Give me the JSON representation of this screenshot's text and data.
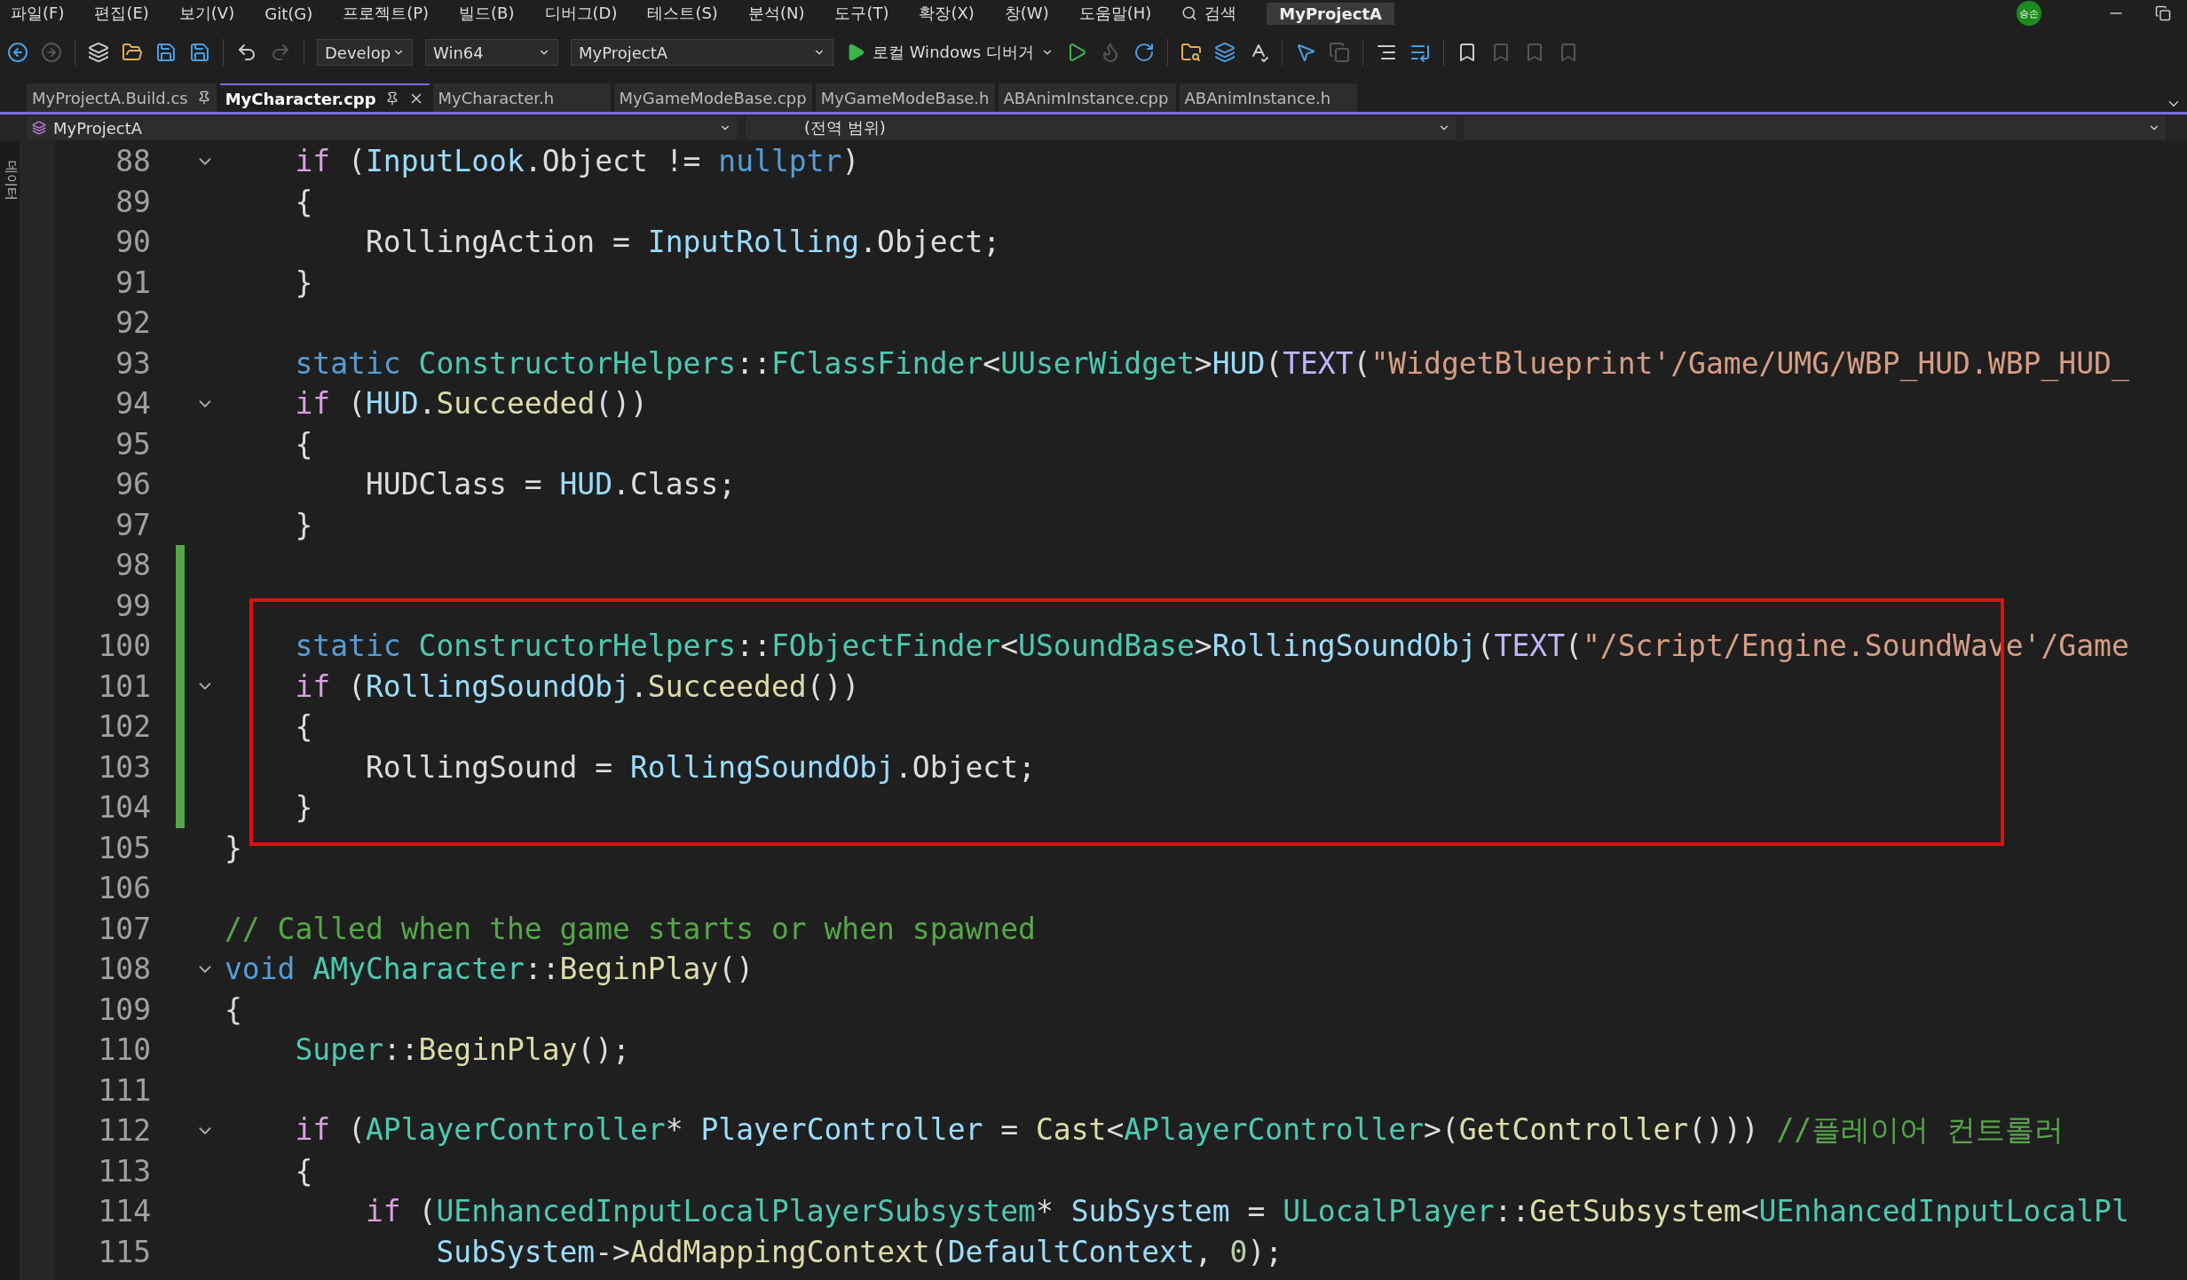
{
  "menu": [
    "파일(F)",
    "편집(E)",
    "보기(V)",
    "Git(G)",
    "프로젝트(P)",
    "빌드(B)",
    "디버그(D)",
    "테스트(S)",
    "분석(N)",
    "도구(T)",
    "확장(X)",
    "창(W)",
    "도움말(H)"
  ],
  "search": {
    "label": "검색"
  },
  "window": {
    "title": "MyProjectA"
  },
  "account": {
    "initials": "승손"
  },
  "toolbar": {
    "configuration": "Develop",
    "platform": "Win64",
    "startup_project": "MyProjectA",
    "run_label": "로컬 Windows 디버거"
  },
  "side_tab": "데이터",
  "tabs": [
    {
      "label": "MyProjectA.Build.cs",
      "selected": false,
      "pinned": true
    },
    {
      "label": "MyCharacter.cpp",
      "selected": true,
      "pinned": true
    },
    {
      "label": "MyCharacter.h",
      "selected": false,
      "pinned": false
    },
    {
      "label": "MyGameModeBase.cpp",
      "selected": false,
      "pinned": false
    },
    {
      "label": "MyGameModeBase.h",
      "selected": false,
      "pinned": false
    },
    {
      "label": "ABAnimInstance.cpp",
      "selected": false,
      "pinned": false
    },
    {
      "label": "ABAnimInstance.h",
      "selected": false,
      "pinned": false
    }
  ],
  "navigation": {
    "project": "MyProjectA",
    "scope": "(전역 범위)"
  },
  "annotation": {
    "kind": "box"
  },
  "lines": [
    {
      "number": "88",
      "changed": false,
      "expanded": true,
      "tokens": [
        {
          "kind": "ctrl",
          "text": "    if"
        },
        {
          "kind": "plain",
          "text": " ("
        },
        {
          "kind": "var",
          "text": "InputLook"
        },
        {
          "kind": "plain",
          "text": ".Object != "
        },
        {
          "kind": "kw",
          "text": "nullptr"
        },
        {
          "kind": "plain",
          "text": ")"
        }
      ]
    },
    {
      "number": "89",
      "changed": false,
      "tokens": [
        {
          "kind": "plain",
          "text": "    {"
        }
      ]
    },
    {
      "number": "90",
      "changed": false,
      "tokens": [
        {
          "kind": "plain",
          "text": "        RollingAction = "
        },
        {
          "kind": "var",
          "text": "InputRolling"
        },
        {
          "kind": "plain",
          "text": ".Object;"
        }
      ]
    },
    {
      "number": "91",
      "changed": false,
      "tokens": [
        {
          "kind": "plain",
          "text": "    }"
        }
      ]
    },
    {
      "number": "92",
      "changed": false
    },
    {
      "number": "93",
      "changed": false,
      "tokens": [
        {
          "kind": "kw",
          "text": "    static "
        },
        {
          "kind": "type",
          "text": "ConstructorHelpers"
        },
        {
          "kind": "plain",
          "text": "::"
        },
        {
          "kind": "type",
          "text": "FClassFinder"
        },
        {
          "kind": "plain",
          "text": "<"
        },
        {
          "kind": "type",
          "text": "UUserWidget"
        },
        {
          "kind": "plain",
          "text": ">"
        },
        {
          "kind": "var",
          "text": "HUD"
        },
        {
          "kind": "plain",
          "text": "("
        },
        {
          "kind": "macro",
          "text": "TEXT"
        },
        {
          "kind": "plain",
          "text": "("
        },
        {
          "kind": "str",
          "text": "\"WidgetBlueprint'/Game/UMG/WBP_HUD.WBP_HUD_"
        }
      ]
    },
    {
      "number": "94",
      "changed": false,
      "expanded": true,
      "tokens": [
        {
          "kind": "ctrl",
          "text": "    if"
        },
        {
          "kind": "plain",
          "text": " ("
        },
        {
          "kind": "var",
          "text": "HUD"
        },
        {
          "kind": "plain",
          "text": "."
        },
        {
          "kind": "fn",
          "text": "Succeeded"
        },
        {
          "kind": "plain",
          "text": "())"
        }
      ]
    },
    {
      "number": "95",
      "changed": false,
      "tokens": [
        {
          "kind": "plain",
          "text": "    {"
        }
      ]
    },
    {
      "number": "96",
      "changed": false,
      "tokens": [
        {
          "kind": "plain",
          "text": "        HUDClass = "
        },
        {
          "kind": "var",
          "text": "HUD"
        },
        {
          "kind": "plain",
          "text": ".Class;"
        }
      ]
    },
    {
      "number": "97",
      "changed": false,
      "tokens": [
        {
          "kind": "plain",
          "text": "    }"
        }
      ]
    },
    {
      "number": "98",
      "changed": true
    },
    {
      "number": "99",
      "changed": true
    },
    {
      "number": "100",
      "changed": true,
      "tokens": [
        {
          "kind": "kw",
          "text": "    static "
        },
        {
          "kind": "type",
          "text": "ConstructorHelpers"
        },
        {
          "kind": "plain",
          "text": "::"
        },
        {
          "kind": "type",
          "text": "FObjectFinder"
        },
        {
          "kind": "plain",
          "text": "<"
        },
        {
          "kind": "type",
          "text": "USoundBase"
        },
        {
          "kind": "plain",
          "text": ">"
        },
        {
          "kind": "var",
          "text": "RollingSoundObj"
        },
        {
          "kind": "plain",
          "text": "("
        },
        {
          "kind": "macro",
          "text": "TEXT"
        },
        {
          "kind": "plain",
          "text": "("
        },
        {
          "kind": "str",
          "text": "\"/Script/Engine.SoundWave'/Game"
        }
      ]
    },
    {
      "number": "101",
      "changed": true,
      "expanded": true,
      "tokens": [
        {
          "kind": "ctrl",
          "text": "    if"
        },
        {
          "kind": "plain",
          "text": " ("
        },
        {
          "kind": "var",
          "text": "RollingSoundObj"
        },
        {
          "kind": "plain",
          "text": "."
        },
        {
          "kind": "fn",
          "text": "Succeeded"
        },
        {
          "kind": "plain",
          "text": "())"
        }
      ]
    },
    {
      "number": "102",
      "changed": true,
      "tokens": [
        {
          "kind": "plain",
          "text": "    {"
        }
      ]
    },
    {
      "number": "103",
      "changed": true,
      "tokens": [
        {
          "kind": "plain",
          "text": "        RollingSound = "
        },
        {
          "kind": "var",
          "text": "RollingSoundObj"
        },
        {
          "kind": "plain",
          "text": ".Object;"
        }
      ]
    },
    {
      "number": "104",
      "changed": true,
      "tokens": [
        {
          "kind": "plain",
          "text": "    }"
        }
      ]
    },
    {
      "number": "105",
      "changed": false,
      "tokens": [
        {
          "kind": "plain",
          "text": "}"
        }
      ]
    },
    {
      "number": "106",
      "changed": false
    },
    {
      "number": "107",
      "changed": false,
      "tokens": [
        {
          "kind": "comment",
          "text": "// Called when the game starts or when spawned"
        }
      ]
    },
    {
      "number": "108",
      "changed": false,
      "expanded": true,
      "tokens": [
        {
          "kind": "kw",
          "text": "void "
        },
        {
          "kind": "type",
          "text": "AMyCharacter"
        },
        {
          "kind": "plain",
          "text": "::"
        },
        {
          "kind": "fn",
          "text": "BeginPlay"
        },
        {
          "kind": "plain",
          "text": "()"
        }
      ]
    },
    {
      "number": "109",
      "changed": false,
      "tokens": [
        {
          "kind": "plain",
          "text": "{"
        }
      ]
    },
    {
      "number": "110",
      "changed": false,
      "tokens": [
        {
          "kind": "type",
          "text": "    Super"
        },
        {
          "kind": "plain",
          "text": "::"
        },
        {
          "kind": "fn",
          "text": "BeginPlay"
        },
        {
          "kind": "plain",
          "text": "();"
        }
      ]
    },
    {
      "number": "111",
      "changed": false
    },
    {
      "number": "112",
      "changed": false,
      "expanded": true,
      "tokens": [
        {
          "kind": "ctrl",
          "text": "    if"
        },
        {
          "kind": "plain",
          "text": " ("
        },
        {
          "kind": "type",
          "text": "APlayerController"
        },
        {
          "kind": "plain",
          "text": "* "
        },
        {
          "kind": "var",
          "text": "PlayerController"
        },
        {
          "kind": "plain",
          "text": " = "
        },
        {
          "kind": "fn",
          "text": "Cast"
        },
        {
          "kind": "plain",
          "text": "<"
        },
        {
          "kind": "type",
          "text": "APlayerController"
        },
        {
          "kind": "plain",
          "text": ">("
        },
        {
          "kind": "fn",
          "text": "GetController"
        },
        {
          "kind": "plain",
          "text": "())) "
        },
        {
          "kind": "comment",
          "text": "//플레이어 컨트롤러"
        }
      ]
    },
    {
      "number": "113",
      "changed": false,
      "tokens": [
        {
          "kind": "plain",
          "text": "    {"
        }
      ]
    },
    {
      "number": "114",
      "changed": false,
      "tokens": [
        {
          "kind": "ctrl",
          "text": "        if"
        },
        {
          "kind": "plain",
          "text": " ("
        },
        {
          "kind": "type",
          "text": "UEnhancedInputLocalPlayerSubsystem"
        },
        {
          "kind": "plain",
          "text": "* "
        },
        {
          "kind": "var",
          "text": "SubSystem"
        },
        {
          "kind": "plain",
          "text": " = "
        },
        {
          "kind": "type",
          "text": "ULocalPlayer"
        },
        {
          "kind": "plain",
          "text": "::"
        },
        {
          "kind": "fn",
          "text": "GetSubsystem"
        },
        {
          "kind": "plain",
          "text": "<"
        },
        {
          "kind": "type",
          "text": "UEnhancedInputLocalPl"
        }
      ]
    },
    {
      "number": "115",
      "changed": false,
      "tokens": [
        {
          "kind": "var",
          "text": "            SubSystem"
        },
        {
          "kind": "plain",
          "text": "->"
        },
        {
          "kind": "fn",
          "text": "AddMappingContext"
        },
        {
          "kind": "plain",
          "text": "("
        },
        {
          "kind": "var",
          "text": "DefaultContext"
        },
        {
          "kind": "plain",
          "text": ", "
        },
        {
          "kind": "num",
          "text": "0"
        },
        {
          "kind": "plain",
          "text": ");"
        }
      ]
    }
  ]
}
